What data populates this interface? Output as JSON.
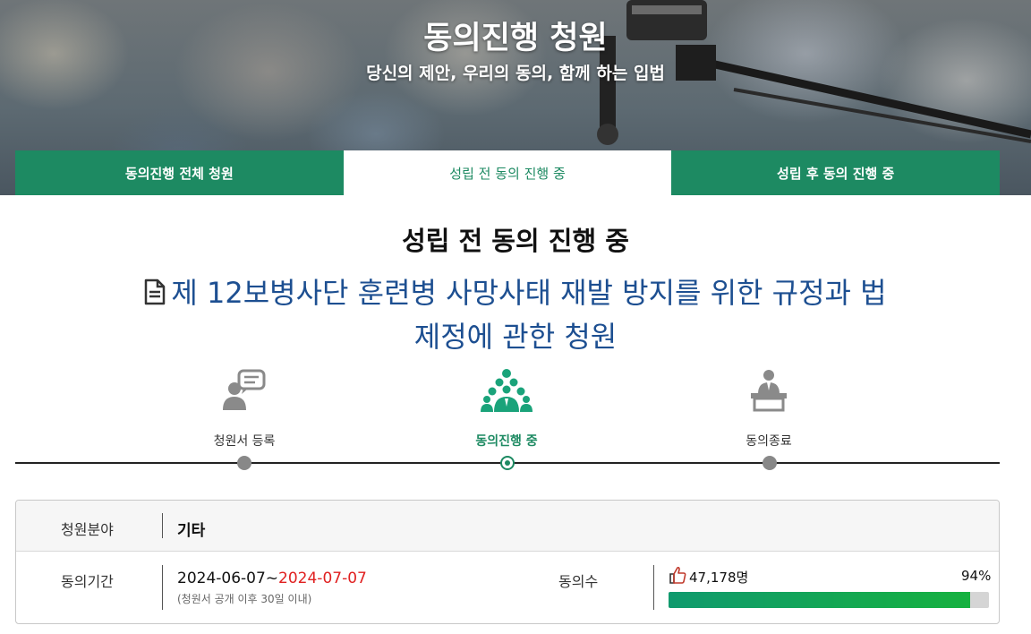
{
  "hero": {
    "title": "동의진행 청원",
    "subtitle": "당신의 제안, 우리의 동의, 함께 하는 입법"
  },
  "tabs": [
    {
      "label": "동의진행 전체 청원",
      "active": false
    },
    {
      "label": "성립 전 동의 진행 중",
      "active": true
    },
    {
      "label": "성립 후 동의 진행 중",
      "active": false
    }
  ],
  "section_title": "성립 전 동의 진행 중",
  "petition": {
    "title_line1": "제 12보병사단 훈련병 사망사태 재발 방지를 위한 규정과 법",
    "title_line2": "제정에 관한 청원",
    "icon": "document-icon"
  },
  "steps": [
    {
      "label": "청원서 등록",
      "icon": "speech-person-icon",
      "active": false
    },
    {
      "label": "동의진행 중",
      "icon": "group-people-icon",
      "active": true
    },
    {
      "label": "동의종료",
      "icon": "podium-speaker-icon",
      "active": false
    }
  ],
  "info": {
    "field_label": "청원분야",
    "field_value": "기타",
    "period_label": "동의기간",
    "period_start": "2024-06-07~",
    "period_end": "2024-07-07",
    "period_note": "(청원서 공개 이후 30일 이내)",
    "count_label": "동의수",
    "count_value": "47,178명",
    "percent_text": "94%",
    "percent_value": 94
  },
  "colors": {
    "brand_green": "#1d8a62",
    "title_blue": "#1d4f91",
    "deadline_red": "#e02020"
  }
}
